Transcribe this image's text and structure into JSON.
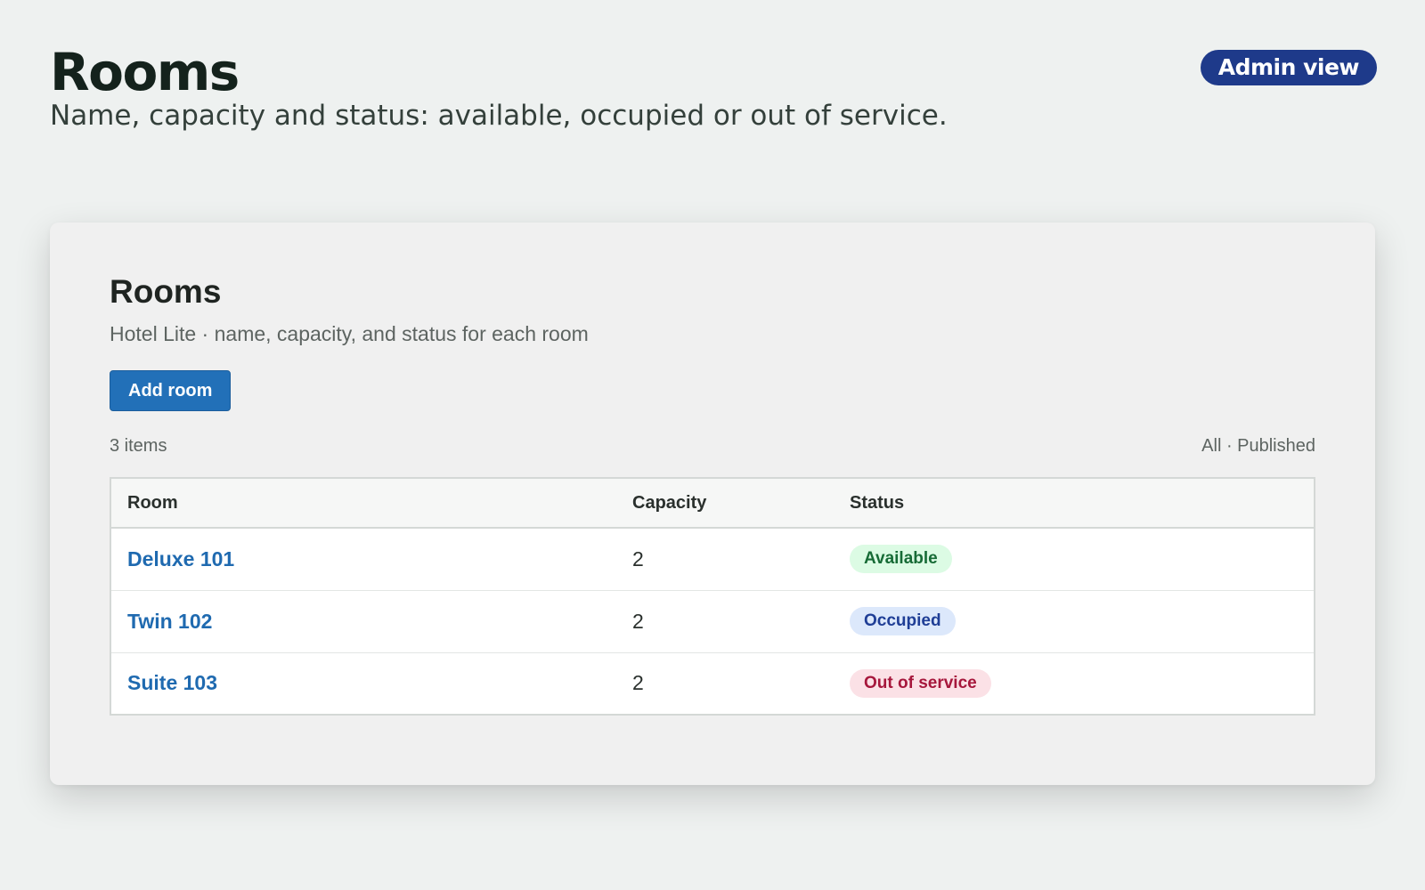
{
  "header": {
    "title": "Rooms",
    "subtitle": "Name, capacity and status: available, occupied or out of service.",
    "badge": "Admin view"
  },
  "panel": {
    "title": "Rooms",
    "subtitle": "Hotel Lite · name, capacity, and status for each room",
    "add_button_label": "Add room",
    "item_count": "3 items",
    "filter_label": "All · Published"
  },
  "table": {
    "columns": [
      "Room",
      "Capacity",
      "Status"
    ],
    "rows": [
      {
        "room": "Deluxe 101",
        "capacity": "2",
        "status": "Available"
      },
      {
        "room": "Twin 102",
        "capacity": "2",
        "status": "Occupied"
      },
      {
        "room": "Suite 103",
        "capacity": "2",
        "status": "Out of service"
      }
    ]
  },
  "colors": {
    "accent": "#2270b8",
    "badge": "#1e3a8a",
    "status_available": "#176b36",
    "status_occupied": "#1f3e96",
    "status_out_of_service": "#a6173c"
  }
}
